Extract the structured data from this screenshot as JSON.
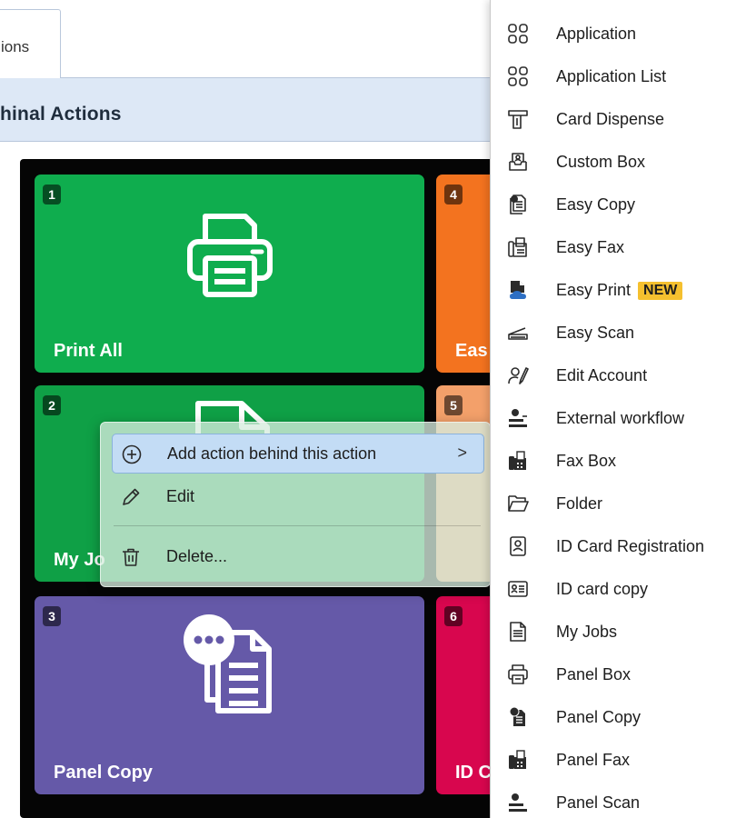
{
  "tab": {
    "label": "ions"
  },
  "header": {
    "title": "hinal Actions"
  },
  "tiles": [
    {
      "number": "1",
      "label": "Print All",
      "color": "#0fad4e",
      "icon": "printer-icon"
    },
    {
      "number": "2",
      "label": "My Jo",
      "color": "#0fa046",
      "icon": "document-icon"
    },
    {
      "number": "3",
      "label": "Panel Copy",
      "color": "#6559a8",
      "icon": "panel-copy-icon"
    },
    {
      "number": "4",
      "label": "Eas",
      "color": "#f3731f",
      "icon": ""
    },
    {
      "number": "5",
      "label": "",
      "color": "#f3a06a",
      "icon": ""
    },
    {
      "number": "6",
      "label": "ID C",
      "color": "#d8064e",
      "icon": ""
    }
  ],
  "context_menu": {
    "items": [
      {
        "label": "Add action behind this action",
        "icon": "plus-circle-icon",
        "has_submenu": true
      },
      {
        "label": "Edit",
        "icon": "pencil-icon",
        "has_submenu": false
      },
      {
        "label": "Delete...",
        "icon": "trash-icon",
        "has_submenu": false
      }
    ],
    "submenu_chevron": ">"
  },
  "submenu": {
    "items": [
      {
        "label": "Application",
        "icon": "grid-icon"
      },
      {
        "label": "Application List",
        "icon": "grid-icon"
      },
      {
        "label": "Card Dispense",
        "icon": "card-dispense-icon"
      },
      {
        "label": "Custom Box",
        "icon": "custom-box-icon"
      },
      {
        "label": "Easy Copy",
        "icon": "copy-icon"
      },
      {
        "label": "Easy Fax",
        "icon": "fax-icon"
      },
      {
        "label": "Easy Print",
        "icon": "cloud-print-icon",
        "badge": "NEW"
      },
      {
        "label": "Easy Scan",
        "icon": "scan-icon"
      },
      {
        "label": "Edit Account",
        "icon": "edit-account-icon"
      },
      {
        "label": "External workflow",
        "icon": "external-workflow-icon"
      },
      {
        "label": "Fax Box",
        "icon": "fax-box-icon"
      },
      {
        "label": "Folder",
        "icon": "folder-icon"
      },
      {
        "label": "ID Card Registration",
        "icon": "id-card-registration-icon"
      },
      {
        "label": "ID card copy",
        "icon": "id-card-icon"
      },
      {
        "label": "My Jobs",
        "icon": "document-icon"
      },
      {
        "label": "Panel Box",
        "icon": "panel-box-icon"
      },
      {
        "label": "Panel Copy",
        "icon": "panel-copy-icon"
      },
      {
        "label": "Panel Fax",
        "icon": "panel-fax-icon"
      },
      {
        "label": "Panel Scan",
        "icon": "panel-scan-icon"
      }
    ]
  }
}
